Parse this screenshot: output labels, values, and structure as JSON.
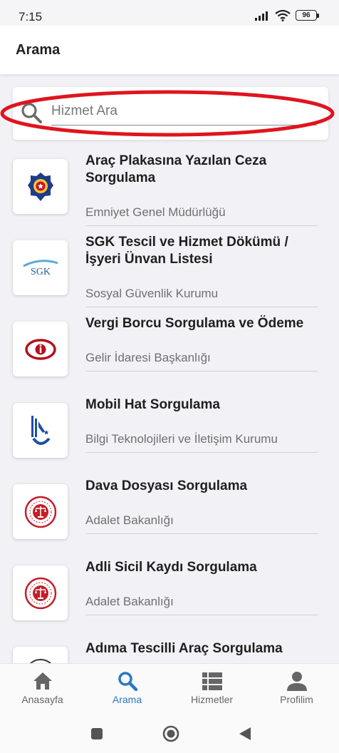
{
  "status_bar": {
    "time": "7:15",
    "battery": "96"
  },
  "app_bar": {
    "title": "Arama"
  },
  "search": {
    "placeholder": "Hizmet Ara",
    "value": ""
  },
  "services": [
    {
      "title": "Araç Plakasına Yazılan Ceza Sorgulama",
      "org": "Emniyet Genel Müdürlüğü",
      "logo": "police-logo-icon"
    },
    {
      "title": "SGK Tescil ve Hizmet Dökümü / İşyeri Ünvan Listesi",
      "org": "Sosyal Güvenlik Kurumu",
      "logo": "sgk-logo-icon",
      "logo_text": "SGK"
    },
    {
      "title": "Vergi Borcu Sorgulama ve Ödeme",
      "org": "Gelir İdaresi Başkanlığı",
      "logo": "gib-logo-icon"
    },
    {
      "title": "Mobil Hat Sorgulama",
      "org": "Bilgi Teknolojileri ve İletişim Kurumu",
      "logo": "btk-logo-icon"
    },
    {
      "title": "Dava Dosyası Sorgulama",
      "org": "Adalet Bakanlığı",
      "logo": "justice-logo-icon"
    },
    {
      "title": "Adli Sicil Kaydı Sorgulama",
      "org": "Adalet Bakanlığı",
      "logo": "justice-logo-icon"
    },
    {
      "title": "Adıma Tescilli Araç Sorgulama",
      "org": "",
      "logo": "partial-logo-icon"
    }
  ],
  "bottom_nav": [
    {
      "label": "Anasayfa",
      "icon": "home-icon",
      "active": false
    },
    {
      "label": "Arama",
      "icon": "search-icon",
      "active": true
    },
    {
      "label": "Hizmetler",
      "icon": "list-icon",
      "active": false
    },
    {
      "label": "Profilim",
      "icon": "person-icon",
      "active": false
    }
  ],
  "colors": {
    "accent": "#2a78c4",
    "annotation": "#e0141e",
    "background": "#f2f2f6"
  }
}
